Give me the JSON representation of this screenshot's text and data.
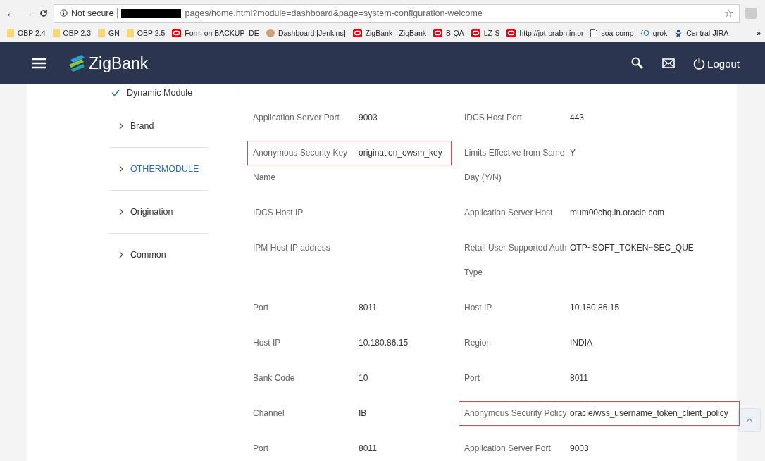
{
  "browser": {
    "back": "←",
    "forward": "→",
    "star": "☆",
    "security_label": "Not secure",
    "url": "pages/home.html?module=dashboard&page=system-configuration-welcome",
    "bookmarks": [
      {
        "label": "OBP 2.4",
        "kind": "folder"
      },
      {
        "label": "OBP 2.3",
        "kind": "folder"
      },
      {
        "label": "GN",
        "kind": "folder"
      },
      {
        "label": "OBP 2.5",
        "kind": "folder"
      },
      {
        "label": "Form on BACKUP_DE",
        "kind": "oracle"
      },
      {
        "label": "Dashboard [Jenkins]",
        "kind": "avatar"
      },
      {
        "label": "ZigBank - ZigBank",
        "kind": "oracle"
      },
      {
        "label": "B-QA",
        "kind": "oracle"
      },
      {
        "label": "LZ-S",
        "kind": "oracle"
      },
      {
        "label": "http://jot-prabh.in.or",
        "kind": "oracle"
      },
      {
        "label": "soa-comp",
        "kind": "page"
      },
      {
        "label": "grok",
        "kind": "brace",
        "glyph": "{O"
      },
      {
        "label": "Central-JIRA",
        "kind": "jira"
      }
    ],
    "more": "»"
  },
  "header": {
    "brand": "ZigBank",
    "logout": "Logout"
  },
  "sidebar": [
    {
      "label": "Dynamic Module",
      "kind": "done",
      "selected": false
    },
    {
      "label": "Brand",
      "kind": "nav",
      "selected": false
    },
    {
      "label": "OTHERMODULE",
      "kind": "nav",
      "selected": true
    },
    {
      "label": "Origination",
      "kind": "nav",
      "selected": false
    },
    {
      "label": "Common",
      "kind": "nav",
      "selected": false
    }
  ],
  "details": [
    [
      {
        "label": "Application Server Port",
        "value": "9003",
        "highlighted": false
      },
      {
        "label": "IDCS Host Port",
        "value": "443",
        "highlighted": false
      }
    ],
    [
      {
        "label": "Anonymous Security Key Name",
        "value": "origination_owsm_key",
        "highlighted": true
      },
      {
        "label": "Limits Effective from Same Day (Y/N)",
        "value": "Y",
        "highlighted": false
      }
    ],
    [
      {
        "label": "IDCS Host IP",
        "highlighted": false
      },
      {
        "label": "Application Server Host",
        "value": "mum00chq.in.oracle.com",
        "highlighted": false
      }
    ],
    [
      {
        "label": "IPM Host IP address",
        "highlighted": false
      },
      {
        "label": "Retail User Supported Auth Type",
        "value": "OTP~SOFT_TOKEN~SEC_QUE",
        "highlighted": false
      }
    ],
    [
      {
        "label": "Port",
        "value": "8011",
        "highlighted": false
      },
      {
        "label": "Host IP",
        "value": "10.180.86.15",
        "highlighted": false
      }
    ],
    [
      {
        "label": "Host IP",
        "value": "10.180.86.15",
        "highlighted": false
      },
      {
        "label": "Region",
        "value": "INDIA",
        "highlighted": false
      }
    ],
    [
      {
        "label": "Bank Code",
        "value": "10",
        "highlighted": false
      },
      {
        "label": "Port",
        "value": "8011",
        "highlighted": false
      }
    ],
    [
      {
        "label": "Channel",
        "value": "IB",
        "highlighted": false
      },
      {
        "label": "Anonymous Security Policy",
        "value": "oracle/wss_username_token_client_policy",
        "highlighted": true
      }
    ],
    [
      {
        "label": "Port",
        "value": "8011",
        "highlighted": false
      },
      {
        "label": "Application Server Port",
        "value": "9003",
        "highlighted": false
      }
    ]
  ]
}
